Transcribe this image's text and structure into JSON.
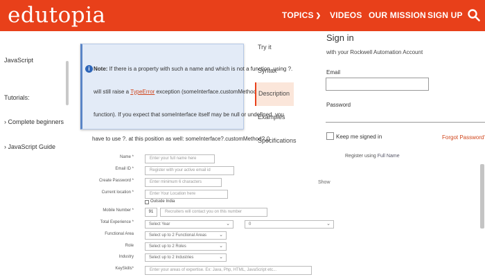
{
  "header": {
    "logo": "edutopia",
    "nav": {
      "topics": "TOPICS",
      "videos": "VIDEOS",
      "mission": "OUR MISSION",
      "signup": "SIGN UP"
    },
    "bg_color": "#e8401a"
  },
  "sidebar": {
    "javascript": "JavaScript",
    "tutorials": "Tutorials:",
    "beginners": "› Complete beginners",
    "guide": "› JavaScript Guide"
  },
  "note": {
    "bold": "Note:",
    "line1_rest": " If there is a property with such a name and which is not a function, using ?.",
    "line2_pre": "will still raise a ",
    "line2_link": "TypeError",
    "line2_post": " exception (someInterface.customMethod is not a",
    "line3": "function). If you expect that someInterface itself may be null or undefined, you",
    "below": "have to use ?. at this position as well: someInterface?.customMethod?.()"
  },
  "middle_links": {
    "try": "Try it",
    "syntax": "Syntax",
    "description": "Description",
    "examples": "Examples",
    "specifications": "Specifications"
  },
  "signin": {
    "title": "Sign in",
    "subtitle": "with your Rockwell Automation Account",
    "email_label": "Email",
    "password_label": "Password",
    "keep": "Keep me signed in",
    "forgot": "Forgot Password?"
  },
  "form": {
    "register_using_prefix": "Register using ",
    "register_using_link": "Full Name",
    "show": "Show",
    "name_label": "Name *",
    "name_ph": "Enter your full name here",
    "email_label": "Email ID *",
    "email_ph": "Register with your active email id",
    "password_label": "Create Password *",
    "password_ph": "Enter minimum 6 characters",
    "location_label": "Current location *",
    "location_ph": "Enter Your Location here",
    "outside_india": "Outside India",
    "mobile_label": "Mobile Number *",
    "country_code": "91",
    "mobile_ph": "Recruiters will contact you on this number",
    "experience_label": "Total Experience *",
    "exp_year": "Select Year",
    "exp_month": "0",
    "functional_label": "Functional Area",
    "functional_ph": "Select up to 2 Functional Areas",
    "role_label": "Role",
    "role_ph": "Select up to 2 Roles",
    "industry_label": "Industry",
    "industry_ph": "Select up to 2 Industries",
    "keyskills_label": "KeySkills*",
    "keyskills_ph": "Enter your areas of expertise. Ex: Java, Php, HTML, JavaScript etc..."
  }
}
